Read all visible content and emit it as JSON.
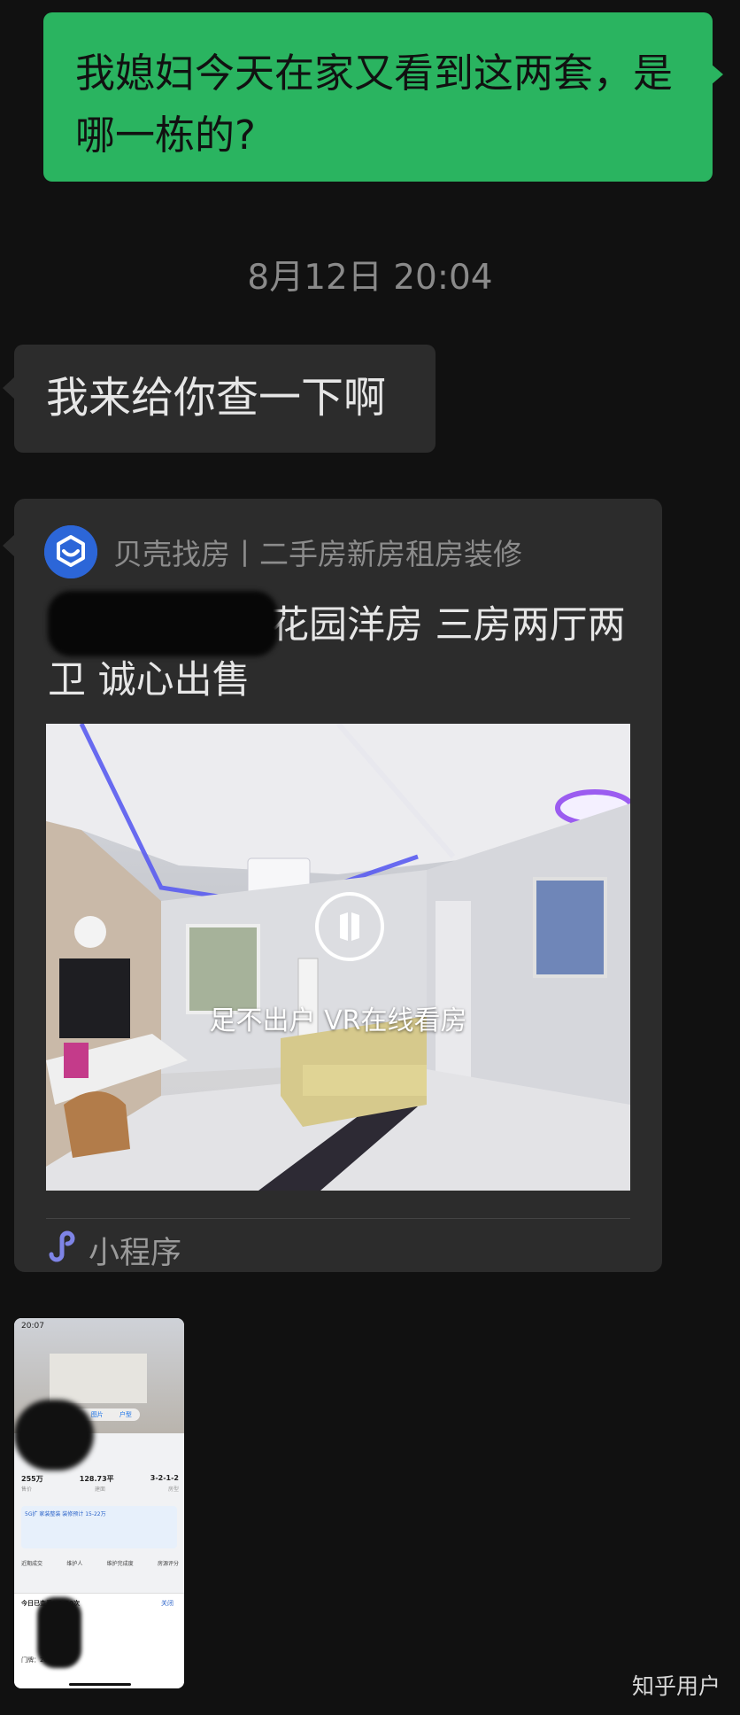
{
  "messages": {
    "sent_text": "我媳妇今天在家又看到这两套，是哪一栋的?",
    "timestamp": "8月12日 20:04",
    "reply_text": "我来给你查一下啊"
  },
  "mini_program_card": {
    "app_name": "贝壳找房丨二手房新房租房装修",
    "title": "花园洋房 三房两厅两卫 诚心出售",
    "thumbnail_caption": "足不出户 VR在线看房",
    "type_label": "小程序",
    "logo_icon": "beike-logo-icon",
    "accent_color": "#2c66d8"
  },
  "screenshot_thumb": {
    "status_time": "20:07",
    "tabs": [
      "VR",
      "图片",
      "户型"
    ],
    "stats": [
      "255万",
      "128.73平",
      "3-2-1-2"
    ],
    "stat_labels": [
      "售价",
      "建面",
      "房型"
    ],
    "promo": "5G扩 家装整装 装修预计 15-22万",
    "row_labels": [
      "近期成交",
      "维护人",
      "维护完成度",
      "房源评分"
    ],
    "popup_title": "今日已查看：1/30次",
    "popup_close": "关闭",
    "popup_number": "门牌：203"
  },
  "watermark": "知乎用户"
}
